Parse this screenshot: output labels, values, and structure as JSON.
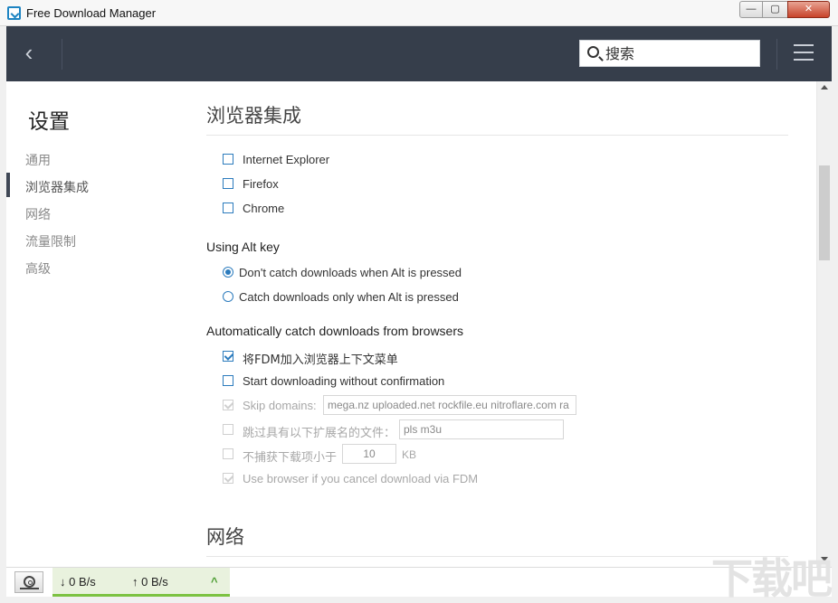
{
  "window": {
    "title": "Free Download Manager",
    "controls": {
      "minimize": "—",
      "maximize": "▢",
      "close": "✕"
    }
  },
  "toolbar": {
    "back_glyph": "‹",
    "search_placeholder": "搜索"
  },
  "sidebar": {
    "heading": "设置",
    "items": [
      {
        "label": "通用",
        "active": false
      },
      {
        "label": "浏览器集成",
        "active": true
      },
      {
        "label": "网络",
        "active": false
      },
      {
        "label": "流量限制",
        "active": false
      },
      {
        "label": "高级",
        "active": false
      }
    ]
  },
  "browser_section": {
    "title": "浏览器集成",
    "browsers": [
      {
        "label": "Internet Explorer",
        "checked": false
      },
      {
        "label": "Firefox",
        "checked": false
      },
      {
        "label": "Chrome",
        "checked": false
      }
    ],
    "alt_key": {
      "label": "Using Alt key",
      "options": [
        {
          "label": "Don't catch downloads when Alt is pressed",
          "selected": true
        },
        {
          "label": "Catch downloads only when Alt is pressed",
          "selected": false
        }
      ]
    },
    "auto_catch": {
      "label": "Automatically catch downloads from browsers",
      "add_context_menu": {
        "label": "将FDM加入浏览器上下文菜单",
        "checked": true,
        "enabled": true
      },
      "start_without_confirmation": {
        "label": "Start downloading without confirmation",
        "checked": false,
        "enabled": true
      },
      "skip_domains": {
        "label": "Skip domains:",
        "checked": true,
        "enabled": false,
        "value": "mega.nz uploaded.net rockfile.eu nitroflare.com ra"
      },
      "skip_extensions": {
        "label": "跳过具有以下扩展名的文件：",
        "checked": false,
        "enabled": false,
        "value": "pls m3u"
      },
      "min_size": {
        "label": "不捕获下载项小于",
        "checked": false,
        "enabled": false,
        "value": "10",
        "unit": "KB"
      },
      "use_browser_on_cancel": {
        "label": "Use browser if you cancel download via FDM",
        "checked": true,
        "enabled": false
      }
    }
  },
  "network_section": {
    "title": "网络"
  },
  "statusbar": {
    "download_speed": "↓  0 B/s",
    "upload_speed": "↑  0 B/s",
    "expand_glyph": "^"
  },
  "watermark": {
    "text": "下载吧"
  },
  "colors": {
    "toolbar_bg": "#363e4b",
    "accent": "#2b7bbd",
    "speed_panel_bg": "#e9f2de",
    "speed_panel_border": "#7cc242"
  }
}
